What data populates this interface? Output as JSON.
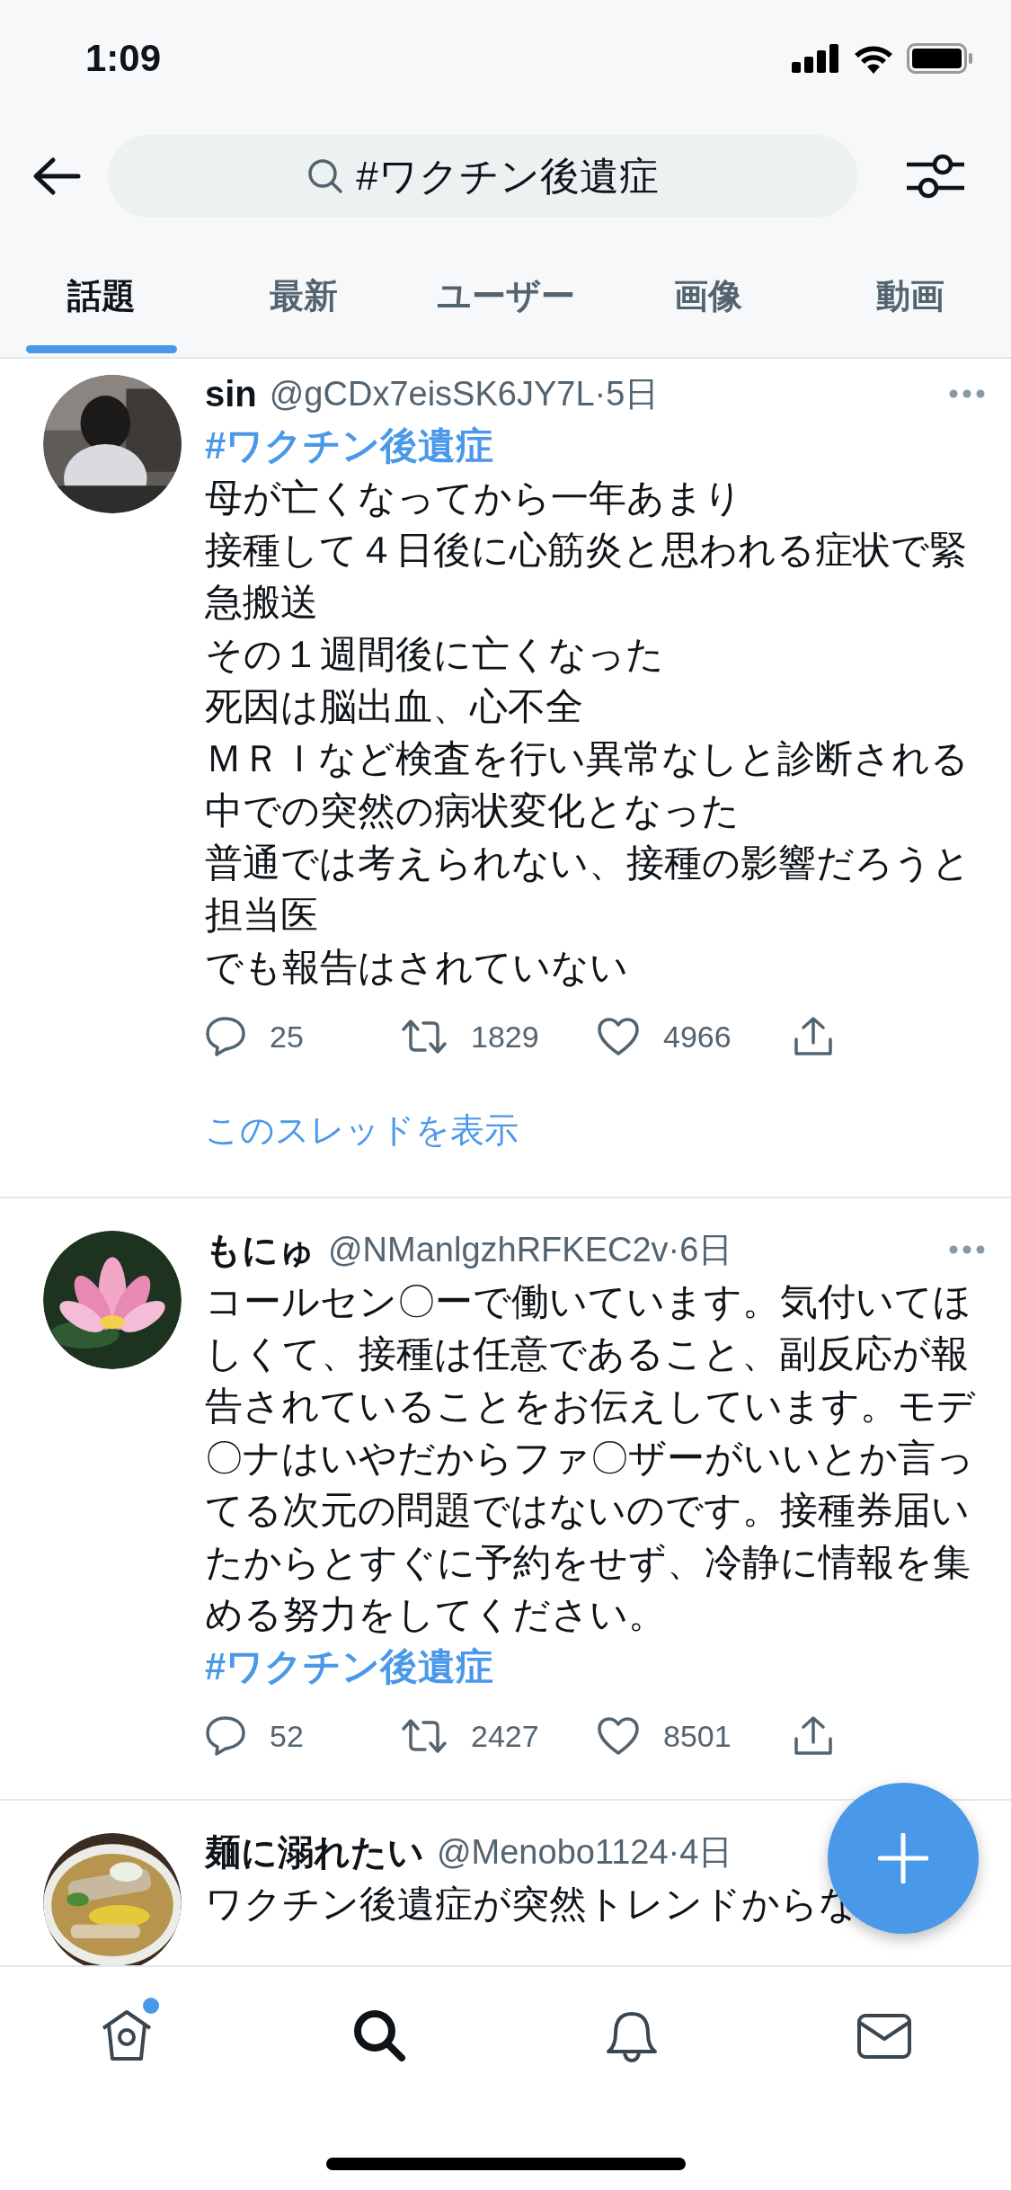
{
  "status_bar": {
    "time": "1:09"
  },
  "search": {
    "value": "#ワクチン後遺症"
  },
  "tabs": [
    {
      "label": "話題",
      "selected": true
    },
    {
      "label": "最新",
      "selected": false
    },
    {
      "label": "ユーザー",
      "selected": false
    },
    {
      "label": "画像",
      "selected": false
    },
    {
      "label": "動画",
      "selected": false
    }
  ],
  "tweets": [
    {
      "name": "sin",
      "meta": "@gCDx7eisSK6JY7L·5日",
      "more": true,
      "body": [
        {
          "kind": "hashtag",
          "text": "#ワクチン後遺症"
        },
        {
          "kind": "text",
          "text": "母が亡くなってから一年あまり"
        },
        {
          "kind": "text",
          "text": "接種して４日後に心筋炎と思われる症状で緊急搬送"
        },
        {
          "kind": "text",
          "text": "その１週間後に亡くなった"
        },
        {
          "kind": "text",
          "text": "死因は脳出血、心不全"
        },
        {
          "kind": "text",
          "text": "ＭＲＩなど検査を行い異常なしと診断される中での突然の病状変化となった"
        },
        {
          "kind": "text",
          "text": "普通では考えられない、接種の影響だろうと担当医"
        },
        {
          "kind": "text",
          "text": "でも報告はされていない"
        }
      ],
      "replies": "25",
      "retweets": "1829",
      "likes": "4966",
      "thread_link": "このスレッドを表示"
    },
    {
      "name": "もにゅ",
      "meta": "@NManlgzhRFKEC2v·6日",
      "more": true,
      "body": [
        {
          "kind": "text",
          "text": "コールセン〇ーで働いています。気付いてほしくて、接種は任意であること、副反応が報告されていることをお伝えしています。モデ〇ナはいやだからファ〇ザーがいいとか言ってる次元の問題ではないのです。接種券届いたからとすぐに予約をせず、冷静に情報を集める努力をしてください。"
        },
        {
          "kind": "hashtag",
          "text": "#ワクチン後遺症"
        }
      ],
      "replies": "52",
      "retweets": "2427",
      "likes": "8501"
    },
    {
      "name": "麺に溺れたい",
      "meta": "@Menobo1124·4日",
      "body": [
        {
          "kind": "text",
          "text": "ワクチン後遺症が突然トレンドからな"
        }
      ]
    }
  ],
  "nav": [
    {
      "kind": "home",
      "selected": false,
      "dot": true
    },
    {
      "kind": "search",
      "selected": true,
      "dot": false
    },
    {
      "kind": "notifications",
      "selected": false,
      "dot": false
    },
    {
      "kind": "messages",
      "selected": false,
      "dot": false
    }
  ]
}
